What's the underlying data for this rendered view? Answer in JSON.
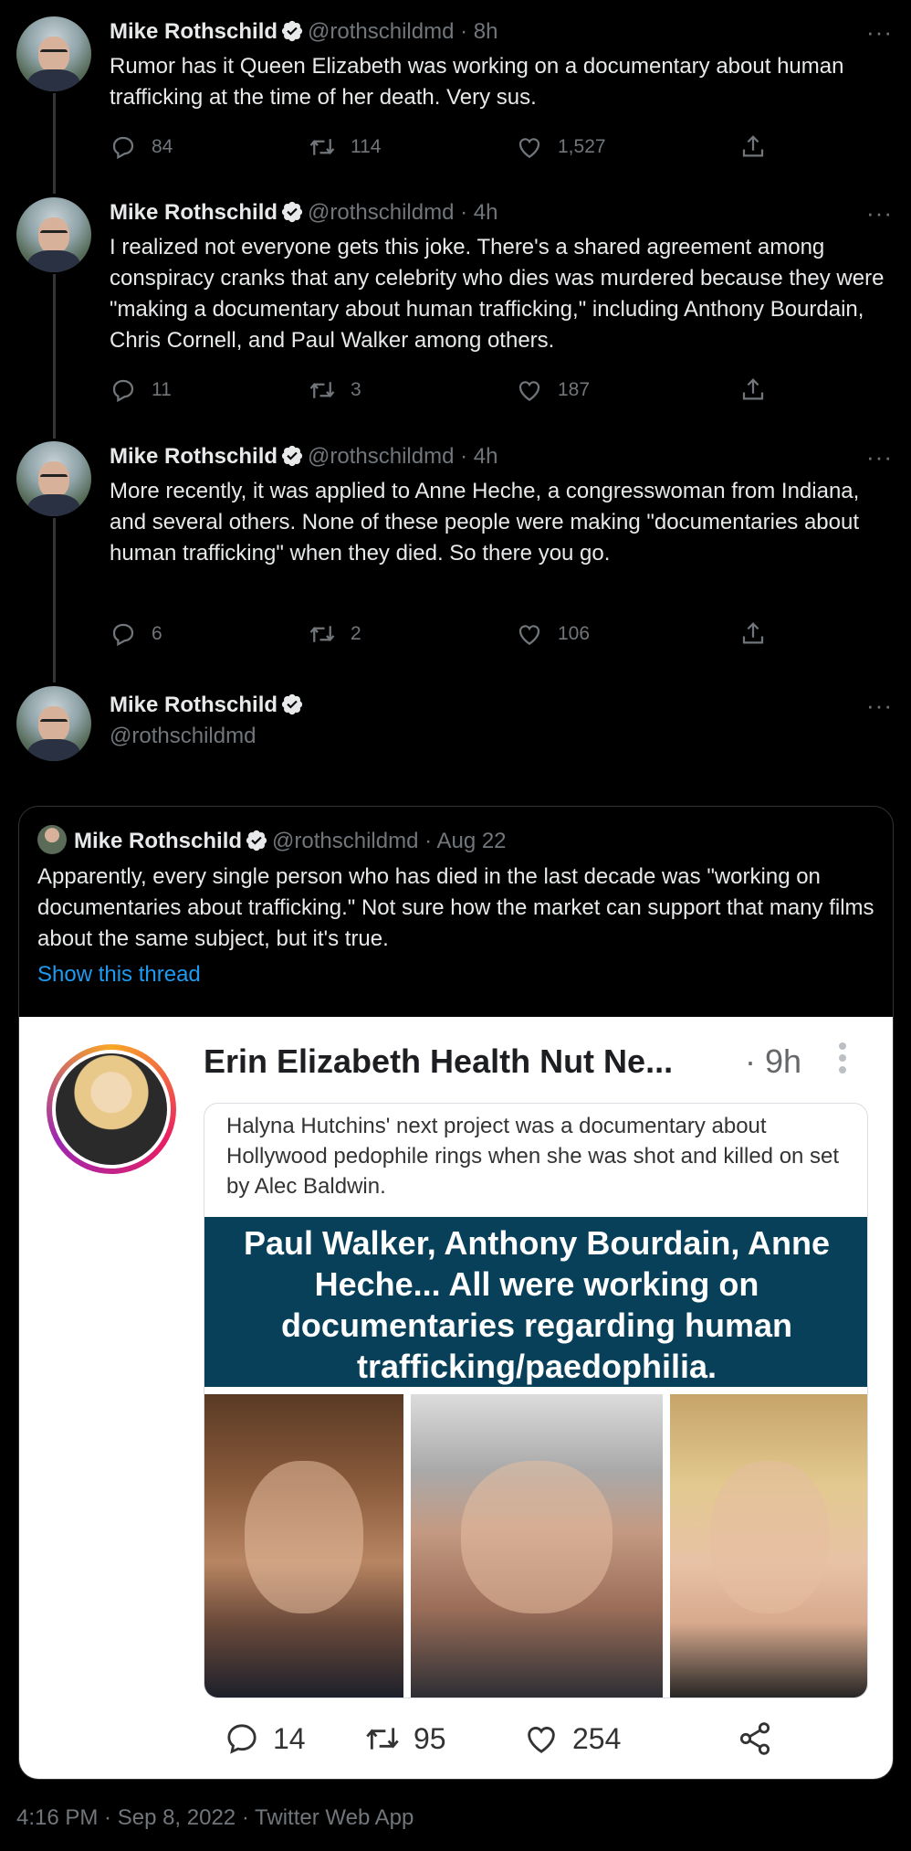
{
  "author": {
    "name": "Mike Rothschild",
    "handle": "@rothschildmd"
  },
  "tweets": [
    {
      "time": "· 8h",
      "text": "Rumor has it Queen Elizabeth was working on a documentary about human trafficking at the time of her death. Very sus.",
      "replies": "84",
      "retweets": "114",
      "likes": "1,527"
    },
    {
      "time": "· 4h",
      "text": "I realized not everyone gets this joke. There's a shared agreement among conspiracy cranks that any celebrity who dies was murdered because they were \"making a documentary about human trafficking,\" including Anthony Bourdain, Chris Cornell, and Paul Walker among others.",
      "replies": "11",
      "retweets": "3",
      "likes": "187"
    },
    {
      "time": "· 4h",
      "text": "More recently, it was applied to Anne Heche, a congresswoman from Indiana, and several others. None of these people were making \"documentaries about human trafficking\" when they died. So there you go.",
      "replies": "6",
      "retweets": "2",
      "likes": "106"
    }
  ],
  "main_tweet": {
    "name": "Mike Rothschild",
    "handle": "@rothschildmd"
  },
  "quoted": {
    "name": "Mike Rothschild",
    "handle": "@rothschildmd",
    "time": "· Aug 22",
    "text": "Apparently, every single person who has died in the last decade was \"working on documentaries about trafficking.\" Not sure how the market can support that many films about the same subject, but it's true.",
    "show_thread": "Show this thread",
    "screenshot": {
      "page_name": "Erin Elizabeth Health Nut Ne...",
      "time": "· 9h",
      "caption": "Halyna Hutchins' next project was a documentary about Hollywood pedophile rings when she was shot and killed on set by Alec Baldwin.",
      "banner": "Paul Walker, Anthony Bourdain, Anne Heche... All were working on documentaries regarding human trafficking/paedophilia.",
      "comments": "14",
      "shares": "95",
      "likes": "254"
    }
  },
  "footer": "4:16 PM · Sep 8, 2022 · Twitter Web App",
  "more_label": "···",
  "colors": {
    "background": "#000000",
    "text": "#e7e9ea",
    "muted": "#71767b",
    "link": "#1d9bf0",
    "verified": "#e7e9ea",
    "banner": "#08405a"
  },
  "icons": [
    "verified-icon",
    "reply-icon",
    "retweet-icon",
    "like-icon",
    "share-icon",
    "more-icon",
    "comment-icon",
    "share-network-icon"
  ]
}
